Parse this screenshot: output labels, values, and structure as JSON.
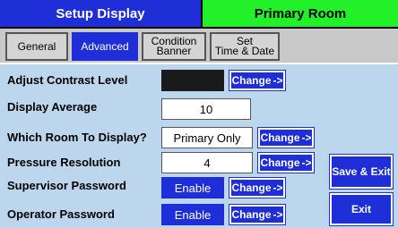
{
  "header": {
    "title": "Setup Display",
    "room": "Primary Room"
  },
  "tabs": [
    {
      "label": "General"
    },
    {
      "label": "Advanced"
    },
    {
      "label": "Condition\nBanner"
    },
    {
      "label": "Set\nTime & Date"
    }
  ],
  "rows": {
    "contrast": {
      "label": "Adjust Contrast Level",
      "change": "Change",
      "arrow": "->"
    },
    "average": {
      "label": "Display Average",
      "value": "10"
    },
    "room": {
      "label": "Which Room To Display?",
      "value": "Primary Only",
      "change": "Change",
      "arrow": "->"
    },
    "pressure": {
      "label": "Pressure Resolution",
      "value": "4",
      "change": "Change",
      "arrow": "->"
    },
    "supervisor": {
      "label": "Supervisor Password",
      "value": "Enable",
      "change": "Change",
      "arrow": "->"
    },
    "operator": {
      "label": "Operator Password",
      "value": "Enable",
      "change": "Change",
      "arrow": "->"
    }
  },
  "actions": {
    "save_exit": "Save & Exit",
    "exit": "Exit"
  },
  "colors": {
    "accent": "#1f2fd8",
    "room_banner": "#22f12a",
    "panel": "#bcd6ee"
  }
}
